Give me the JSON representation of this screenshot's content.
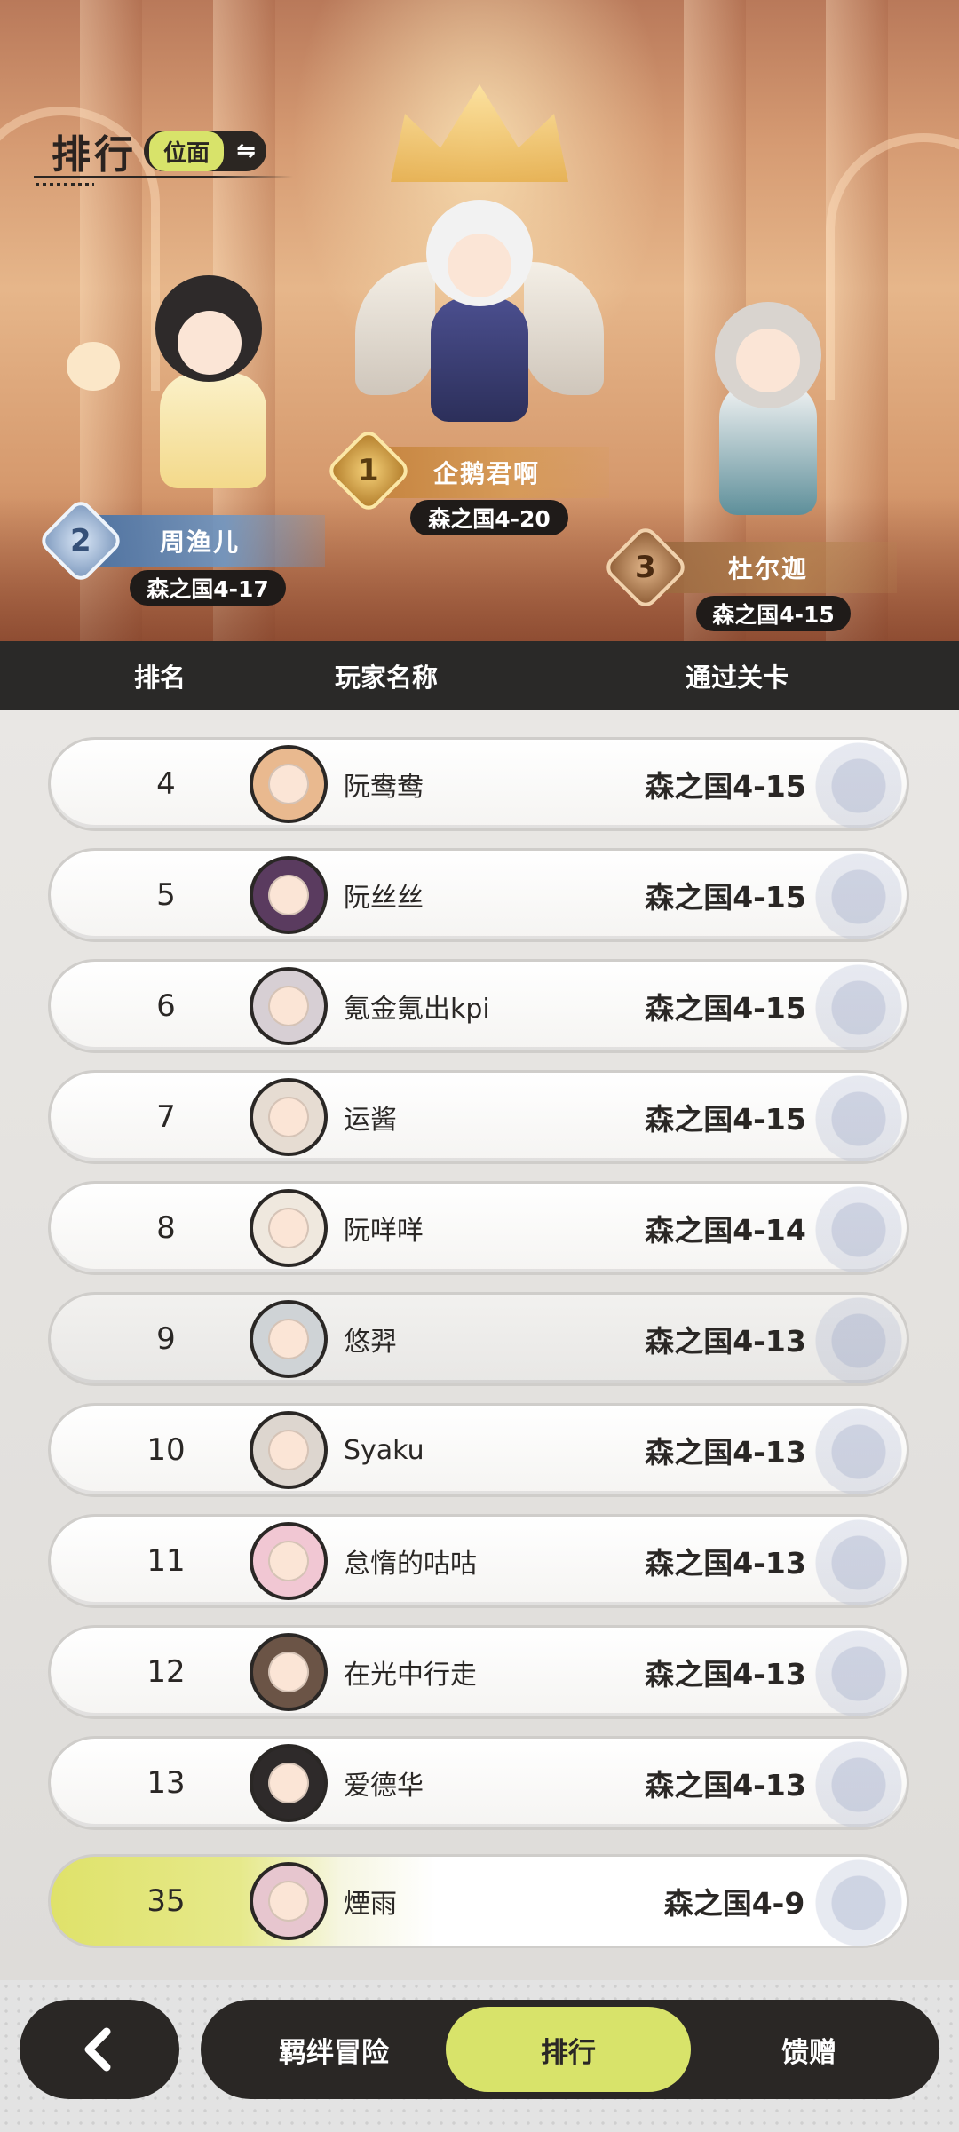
{
  "header": {
    "title": "排行",
    "mode_label": "位面",
    "mode_swap_icon": "⇋"
  },
  "podium": {
    "first": {
      "rank": "1",
      "name": "企鹅君啊",
      "stage": "森之国4-20"
    },
    "second": {
      "rank": "2",
      "name": "周渔儿",
      "stage": "森之国4-17"
    },
    "third": {
      "rank": "3",
      "name": "杜尔迦",
      "stage": "森之国4-15"
    }
  },
  "columns": {
    "rank": "排名",
    "player_name": "玩家名称",
    "stage": "通过关卡"
  },
  "rows": [
    {
      "rank": "4",
      "name": "阮鸯鸯",
      "stage": "森之国4-15"
    },
    {
      "rank": "5",
      "name": "阮丝丝",
      "stage": "森之国4-15"
    },
    {
      "rank": "6",
      "name": "氪金氪出kpi",
      "stage": "森之国4-15"
    },
    {
      "rank": "7",
      "name": "运酱",
      "stage": "森之国4-15"
    },
    {
      "rank": "8",
      "name": "阮咩咩",
      "stage": "森之国4-14"
    },
    {
      "rank": "9",
      "name": "悠羿",
      "stage": "森之国4-13"
    },
    {
      "rank": "10",
      "name": "Syaku",
      "stage": "森之国4-13"
    },
    {
      "rank": "11",
      "name": "怠惰的咕咕",
      "stage": "森之国4-13"
    },
    {
      "rank": "12",
      "name": "在光中行走",
      "stage": "森之国4-13"
    },
    {
      "rank": "13",
      "name": "爱德华",
      "stage": "森之国4-13"
    }
  ],
  "self": {
    "rank": "35",
    "name": "煙雨",
    "stage": "森之国4-9"
  },
  "nav": {
    "back_icon": "chevron-left-icon",
    "tabs": [
      "羁绊冒险",
      "排行",
      "馈赠"
    ],
    "active_tab": "排行"
  },
  "colors": {
    "accent": "#d8e36a",
    "dark": "#2a2725"
  }
}
